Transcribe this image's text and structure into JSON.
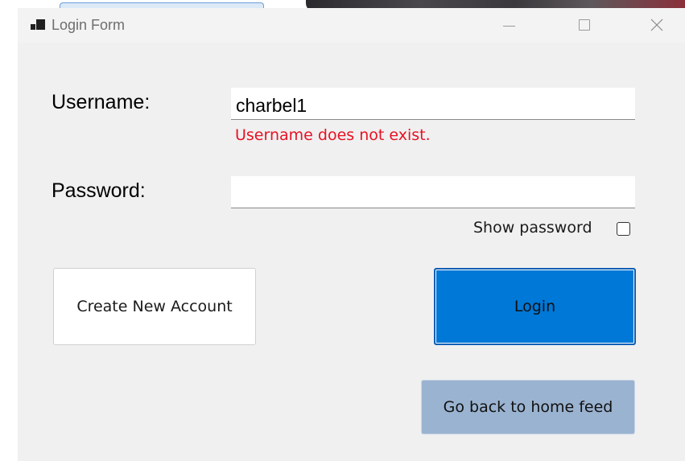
{
  "window": {
    "title": "Login Form"
  },
  "form": {
    "username_label": "Username:",
    "username_value": "charbel1",
    "username_error": "Username does not exist.",
    "password_label": "Password:",
    "password_value": "",
    "show_password_label": "Show password",
    "show_password_checked": false
  },
  "buttons": {
    "create_account": "Create New Account",
    "login": "Login",
    "home_feed": "Go back to home feed"
  },
  "colors": {
    "error": "#e81123",
    "login_button": "#0078d7",
    "home_button": "#9ab3d0",
    "form_background": "#f0f0f0"
  },
  "icons": {
    "app": "window-tiles-icon",
    "minimize": "minimize-icon",
    "maximize": "maximize-icon",
    "close": "close-icon"
  }
}
